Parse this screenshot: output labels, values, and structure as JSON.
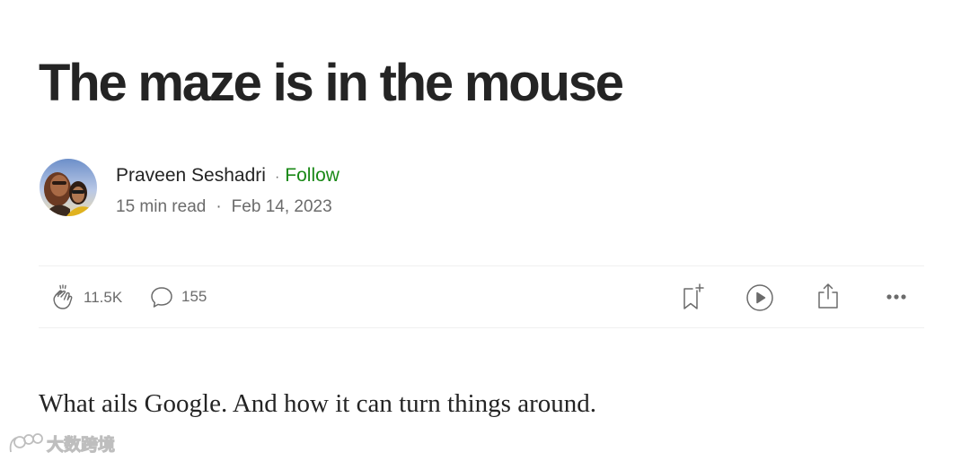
{
  "article": {
    "title": "The maze is in the mouse",
    "subtitle": "What ails Google. And how it can turn things around."
  },
  "byline": {
    "author": "Praveen Seshadri",
    "separator": "·",
    "follow_label": "Follow",
    "read_time": "15 min read",
    "date": "Feb 14, 2023"
  },
  "actions": {
    "claps": "11.5K",
    "responses": "155",
    "icons": [
      "clap-icon",
      "response-icon",
      "bookmark-add-icon",
      "play-icon",
      "share-icon",
      "more-icon"
    ]
  },
  "watermark": {
    "text": "大数跨境"
  },
  "colors": {
    "accent": "#1a8917",
    "text": "#242424",
    "muted": "#6b6b6b",
    "divider": "#f0f0f0"
  }
}
